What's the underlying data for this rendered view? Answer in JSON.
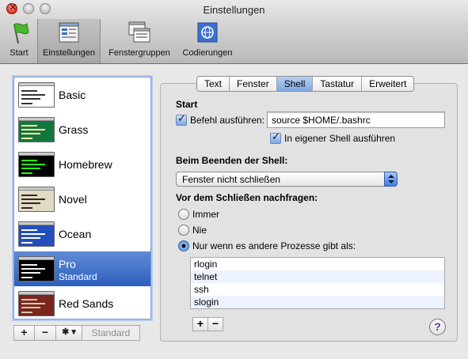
{
  "window": {
    "title": "Einstellungen"
  },
  "toolbar": {
    "items": [
      {
        "label": "Start",
        "icon": "green-flag-icon"
      },
      {
        "label": "Einstellungen",
        "icon": "settings-window-icon",
        "selected": true
      },
      {
        "label": "Fenstergruppen",
        "icon": "window-groups-icon"
      },
      {
        "label": "Codierungen",
        "icon": "encoding-globe-icon"
      }
    ]
  },
  "profiles": {
    "items": [
      {
        "name": "Basic",
        "subtitle": "",
        "bg": "#ffffff",
        "fg": "#222222"
      },
      {
        "name": "Grass",
        "subtitle": "",
        "bg": "#13773d",
        "fg": "#fff0a5"
      },
      {
        "name": "Homebrew",
        "subtitle": "",
        "bg": "#000000",
        "fg": "#28fe14"
      },
      {
        "name": "Novel",
        "subtitle": "",
        "bg": "#dfdbc3",
        "fg": "#3b2322"
      },
      {
        "name": "Ocean",
        "subtitle": "",
        "bg": "#224fbc",
        "fg": "#ffffff"
      },
      {
        "name": "Pro",
        "subtitle": "Standard",
        "bg": "#000000",
        "fg": "#f2f2f2",
        "selected": true
      },
      {
        "name": "Red Sands",
        "subtitle": "",
        "bg": "#7a251e",
        "fg": "#d7c9a7"
      }
    ],
    "add_label": "+",
    "remove_label": "−",
    "gear_label": "✱ ▾",
    "default_label": "Standard"
  },
  "tabs": [
    {
      "label": "Text"
    },
    {
      "label": "Fenster"
    },
    {
      "label": "Shell",
      "active": true
    },
    {
      "label": "Tastatur"
    },
    {
      "label": "Erweitert"
    }
  ],
  "shell": {
    "start_heading": "Start",
    "run_command_label": "Befehl ausführen:",
    "run_command_checked": true,
    "command_value": "source $HOME/.bashrc",
    "own_shell_label": "In eigener Shell ausführen",
    "own_shell_checked": true,
    "on_exit_heading": "Beim Beenden der Shell:",
    "on_exit_value": "Fenster nicht schließen",
    "ask_heading": "Vor dem Schließen nachfragen:",
    "ask_options": [
      {
        "label": "Immer",
        "selected": false
      },
      {
        "label": "Nie",
        "selected": false
      },
      {
        "label": "Nur wenn es andere Prozesse gibt als:",
        "selected": true
      }
    ],
    "processes": [
      "rlogin",
      "telnet",
      "ssh",
      "slogin"
    ],
    "add_label": "+",
    "remove_label": "−",
    "help_label": "?"
  }
}
